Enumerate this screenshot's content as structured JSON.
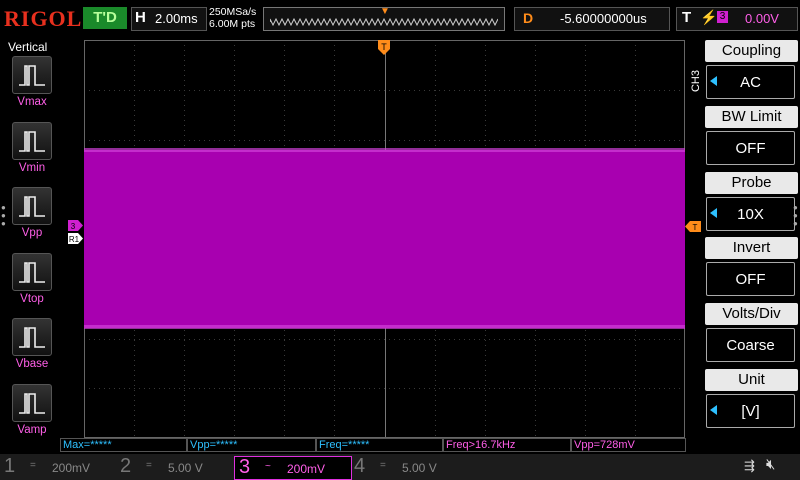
{
  "header": {
    "logo": "RIGOL",
    "trigger_status": "T'D",
    "horizontal_label": "H",
    "timebase": "2.00ms",
    "sample_rate": "250MSa/s",
    "memory_depth": "6.00M pts",
    "delay_label": "D",
    "delay_value": "-5.60000000us",
    "trigger_label": "T",
    "trigger_source": "3",
    "trigger_level": "0.00V"
  },
  "left_panel": {
    "title": "Vertical",
    "items": [
      {
        "label": "Vmax"
      },
      {
        "label": "Vmin"
      },
      {
        "label": "Vpp"
      },
      {
        "label": "Vtop"
      },
      {
        "label": "Vbase"
      },
      {
        "label": "Vamp"
      }
    ]
  },
  "screen": {
    "channel_marker": "3",
    "ref_marker": "R1",
    "trigger_pos_marker": "T"
  },
  "right_menu": {
    "channel": "CH3",
    "items": [
      {
        "title": "Coupling",
        "value": "AC",
        "arrow": true
      },
      {
        "title": "BW Limit",
        "value": "OFF",
        "arrow": false
      },
      {
        "title": "Probe",
        "value": "10X",
        "arrow": true
      },
      {
        "title": "Invert",
        "value": "OFF",
        "arrow": false
      },
      {
        "title": "Volts/Div",
        "value": "Coarse",
        "arrow": false
      },
      {
        "title": "Unit",
        "value": "[V]",
        "arrow": true
      }
    ]
  },
  "measurements": [
    {
      "text": "Max=*****",
      "color": "#2ec0ff"
    },
    {
      "text": "Vpp=*****",
      "color": "#2ec0ff"
    },
    {
      "text": "Freq=*****",
      "color": "#2ec0ff"
    },
    {
      "text": "Freq>16.7kHz",
      "color": "#ff5fe8"
    },
    {
      "text": "Vpp=728mV",
      "color": "#ff5fe8"
    }
  ],
  "channels": [
    {
      "num": "1",
      "icon": "=",
      "scale": "200mV"
    },
    {
      "num": "2",
      "icon": "=",
      "scale": "5.00 V"
    },
    {
      "num": "3",
      "icon": "~",
      "scale": "200mV"
    },
    {
      "num": "4",
      "icon": "=",
      "scale": "5.00 V"
    }
  ],
  "colors": {
    "ch3": "#b000b8",
    "trigger": "#ff8c1a",
    "brand": "#e8301e",
    "grid": "#3a3a3a",
    "menu_arrow": "#2ec0ff"
  },
  "icons": {
    "usb": "usb-icon",
    "speaker": "speaker-muted-icon"
  }
}
